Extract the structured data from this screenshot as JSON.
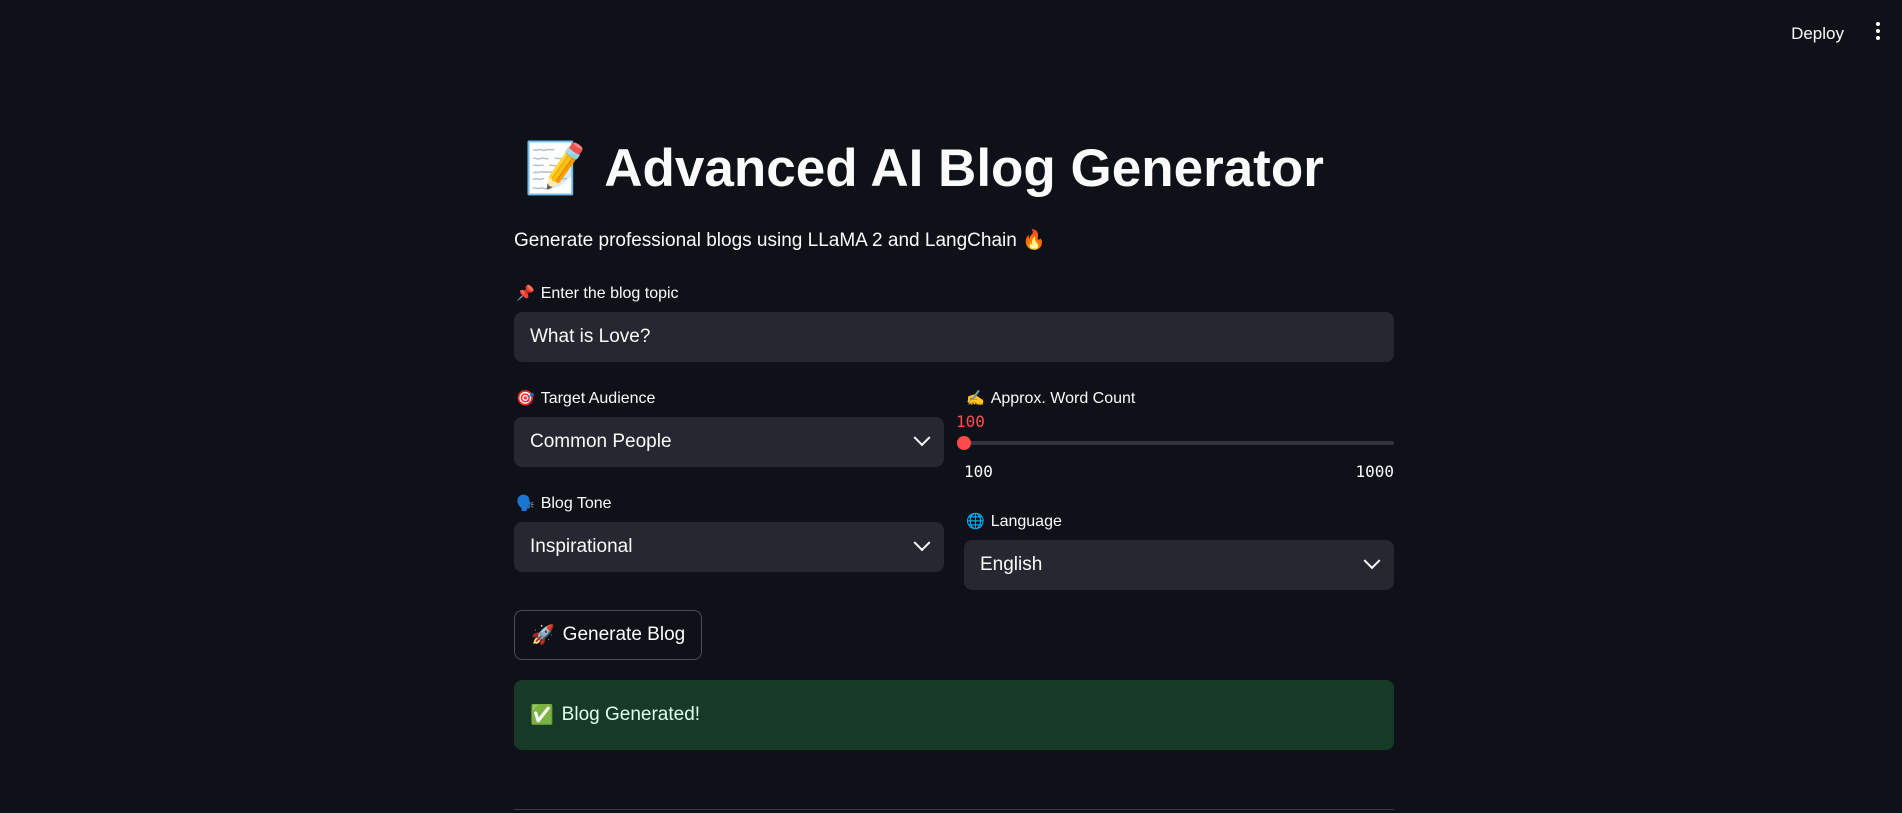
{
  "topbar": {
    "deploy_label": "Deploy",
    "menu_icon": "kebab-menu-icon"
  },
  "header": {
    "title_icon": "📝",
    "title": "Advanced AI Blog Generator",
    "subtitle": "Generate professional blogs using LLaMA 2 and LangChain 🔥"
  },
  "form": {
    "topic": {
      "icon": "📌",
      "label": "Enter the blog topic",
      "value": "What is Love?"
    },
    "audience": {
      "icon": "🎯",
      "label": "Target Audience",
      "selected": "Common People"
    },
    "word_count": {
      "icon": "✍️",
      "label": "Approx. Word Count",
      "value": "100",
      "min": "100",
      "max": "1000",
      "fill_fraction": 0
    },
    "tone": {
      "icon": "🗣️",
      "label": "Blog Tone",
      "selected": "Inspirational"
    },
    "language": {
      "icon": "🌐",
      "label": "Language",
      "selected": "English"
    },
    "generate": {
      "icon": "🚀",
      "label": "Generate Blog"
    }
  },
  "status": {
    "icon": "✅",
    "message": "Blog Generated!"
  },
  "colors": {
    "background": "#0e1117",
    "input_bg": "#262730",
    "accent": "#ff4b4b",
    "success_bg": "#173928"
  }
}
